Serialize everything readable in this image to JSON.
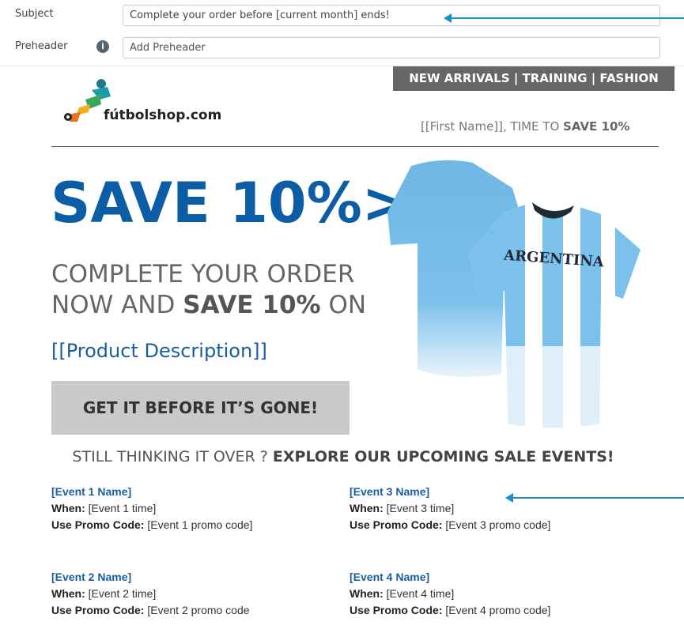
{
  "editor": {
    "subject_label": "Subject",
    "subject_value": "Complete your order before [current month] ends!",
    "preheader_label": "Preheader",
    "preheader_placeholder": "Add Preheader",
    "info_icon": "i"
  },
  "email": {
    "nav": "NEW ARRIVALS | TRAINING | FASHION",
    "logo_text": "fútbolshop.com",
    "greeting_prefix": "[[First Name]], TIME TO ",
    "greeting_bold": "SAVE 10%",
    "save_big": "SAVE 10%>",
    "headline_line1": "COMPLETE YOUR ORDER",
    "headline_line2_prefix": "NOW AND ",
    "headline_line2_bold": "SAVE 10%",
    "headline_line2_suffix": " ON",
    "product_description": "[[Product Description]]",
    "cta_label": "GET IT BEFORE IT’S GONE!",
    "jersey_text": "ARGENTINA",
    "tagline_prefix": "STILL THINKING IT OVER ? ",
    "tagline_bold": "EXPLORE OUR UPCOMING SALE EVENTS!",
    "when_label": "When:",
    "promo_label": "Use Promo Code:",
    "events": [
      {
        "name": "[Event 1 Name]",
        "time": "[Event 1 time]",
        "code": "[Event 1 promo code]"
      },
      {
        "name": "[Event 2 Name]",
        "time": "[Event 2 time]",
        "code": "[Event 2 promo code"
      },
      {
        "name": "[Event 3 Name]",
        "time": "[Event 3 time]",
        "code": "[Event 3 promo code]"
      },
      {
        "name": "[Event 4 Name]",
        "time": "[Event 4 time]",
        "code": "[Event 4 promo code]"
      }
    ]
  },
  "colors": {
    "brand_blue": "#0c5da6",
    "link_blue": "#1a5ea0",
    "nav_bg": "#666666",
    "cta_bg": "#c9c9c9",
    "annotation_arrow": "#1a8fc9"
  }
}
